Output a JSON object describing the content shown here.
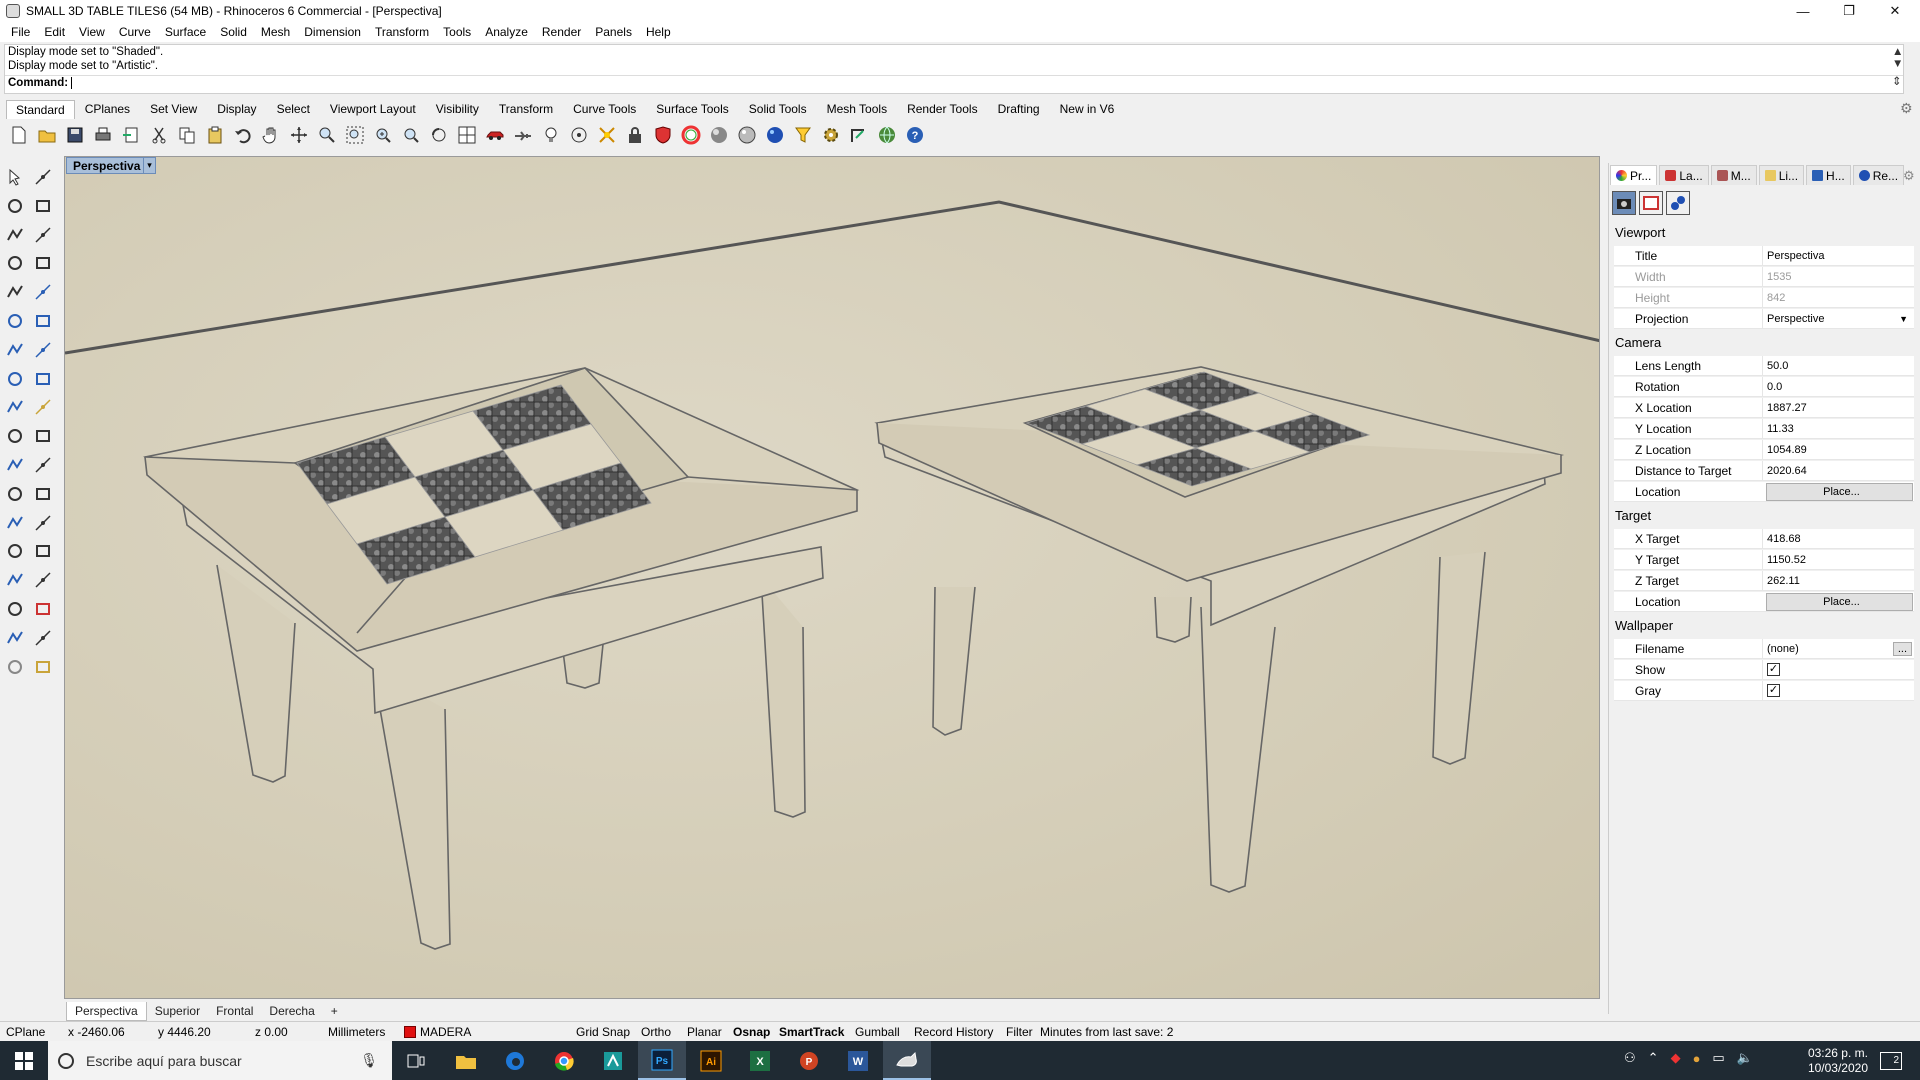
{
  "window": {
    "title": "SMALL 3D TABLE TILES6 (54 MB) - Rhinoceros 6 Commercial - [Perspectiva]",
    "minimize": "—",
    "maximize": "❐",
    "close": "✕"
  },
  "menu": [
    "File",
    "Edit",
    "View",
    "Curve",
    "Surface",
    "Solid",
    "Mesh",
    "Dimension",
    "Transform",
    "Tools",
    "Analyze",
    "Render",
    "Panels",
    "Help"
  ],
  "command": {
    "history": [
      "Display mode set to \"Shaded\".",
      "Display mode set to \"Artistic\"."
    ],
    "prompt": "Command:",
    "value": ""
  },
  "toolbar_tabs": [
    "Standard",
    "CPlanes",
    "Set View",
    "Display",
    "Select",
    "Viewport Layout",
    "Visibility",
    "Transform",
    "Curve Tools",
    "Surface Tools",
    "Solid Tools",
    "Mesh Tools",
    "Render Tools",
    "Drafting",
    "New in V6"
  ],
  "active_toolbar_tab": "Standard",
  "viewport": {
    "title": "Perspectiva",
    "tabs": [
      "Perspectiva",
      "Superior",
      "Frontal",
      "Derecha"
    ],
    "add_tab": "+"
  },
  "panel": {
    "tabs": [
      "Pr...",
      "La...",
      "M...",
      "Li...",
      "H...",
      "Re..."
    ],
    "tab_icons": [
      "properties-icon",
      "layers-icon",
      "materials-icon",
      "libraries-icon",
      "help-icon",
      "render-icon"
    ],
    "sections": {
      "viewport": "Viewport",
      "camera": "Camera",
      "target": "Target",
      "wallpaper": "Wallpaper"
    },
    "viewport_props": {
      "title_label": "Title",
      "title_value": "Perspectiva",
      "width_label": "Width",
      "width_value": "1535",
      "height_label": "Height",
      "height_value": "842",
      "projection_label": "Projection",
      "projection_value": "Perspective"
    },
    "camera_props": {
      "lens_label": "Lens Length",
      "lens_value": "50.0",
      "rotation_label": "Rotation",
      "rotation_value": "0.0",
      "xloc_label": "X Location",
      "xloc_value": "1887.27",
      "yloc_label": "Y Location",
      "yloc_value": "11.33",
      "zloc_label": "Z Location",
      "zloc_value": "1054.89",
      "dist_label": "Distance to Target",
      "dist_value": "2020.64",
      "location_label": "Location",
      "location_button": "Place..."
    },
    "target_props": {
      "xt_label": "X Target",
      "xt_value": "418.68",
      "yt_label": "Y Target",
      "yt_value": "1150.52",
      "zt_label": "Z Target",
      "zt_value": "262.11",
      "location_label": "Location",
      "location_button": "Place..."
    },
    "wallpaper_props": {
      "filename_label": "Filename",
      "filename_value": "(none)",
      "browse_button": "...",
      "show_label": "Show",
      "show_checked": true,
      "gray_label": "Gray",
      "gray_checked": true
    }
  },
  "status": {
    "cplane": "CPlane",
    "x": "x -2460.06",
    "y": "y 4446.20",
    "z": "z 0.00",
    "units": "Millimeters",
    "layer": "MADERA",
    "layer_color": "#e01010",
    "grid_snap": "Grid Snap",
    "ortho": "Ortho",
    "planar": "Planar",
    "osnap": "Osnap",
    "smarttrack": "SmartTrack",
    "gumball": "Gumball",
    "record_history": "Record History",
    "filter": "Filter",
    "save_info": "Minutes from last save: 2"
  },
  "taskbar": {
    "search_placeholder": "Escribe aquí para buscar",
    "time": "03:26 p. m.",
    "date": "10/03/2020",
    "notification_count": "2",
    "apps": [
      "task-view",
      "file-explorer",
      "edge",
      "chrome",
      "app-store",
      "photoshop",
      "illustrator",
      "excel",
      "powerpoint",
      "word",
      "rhinoceros"
    ]
  }
}
